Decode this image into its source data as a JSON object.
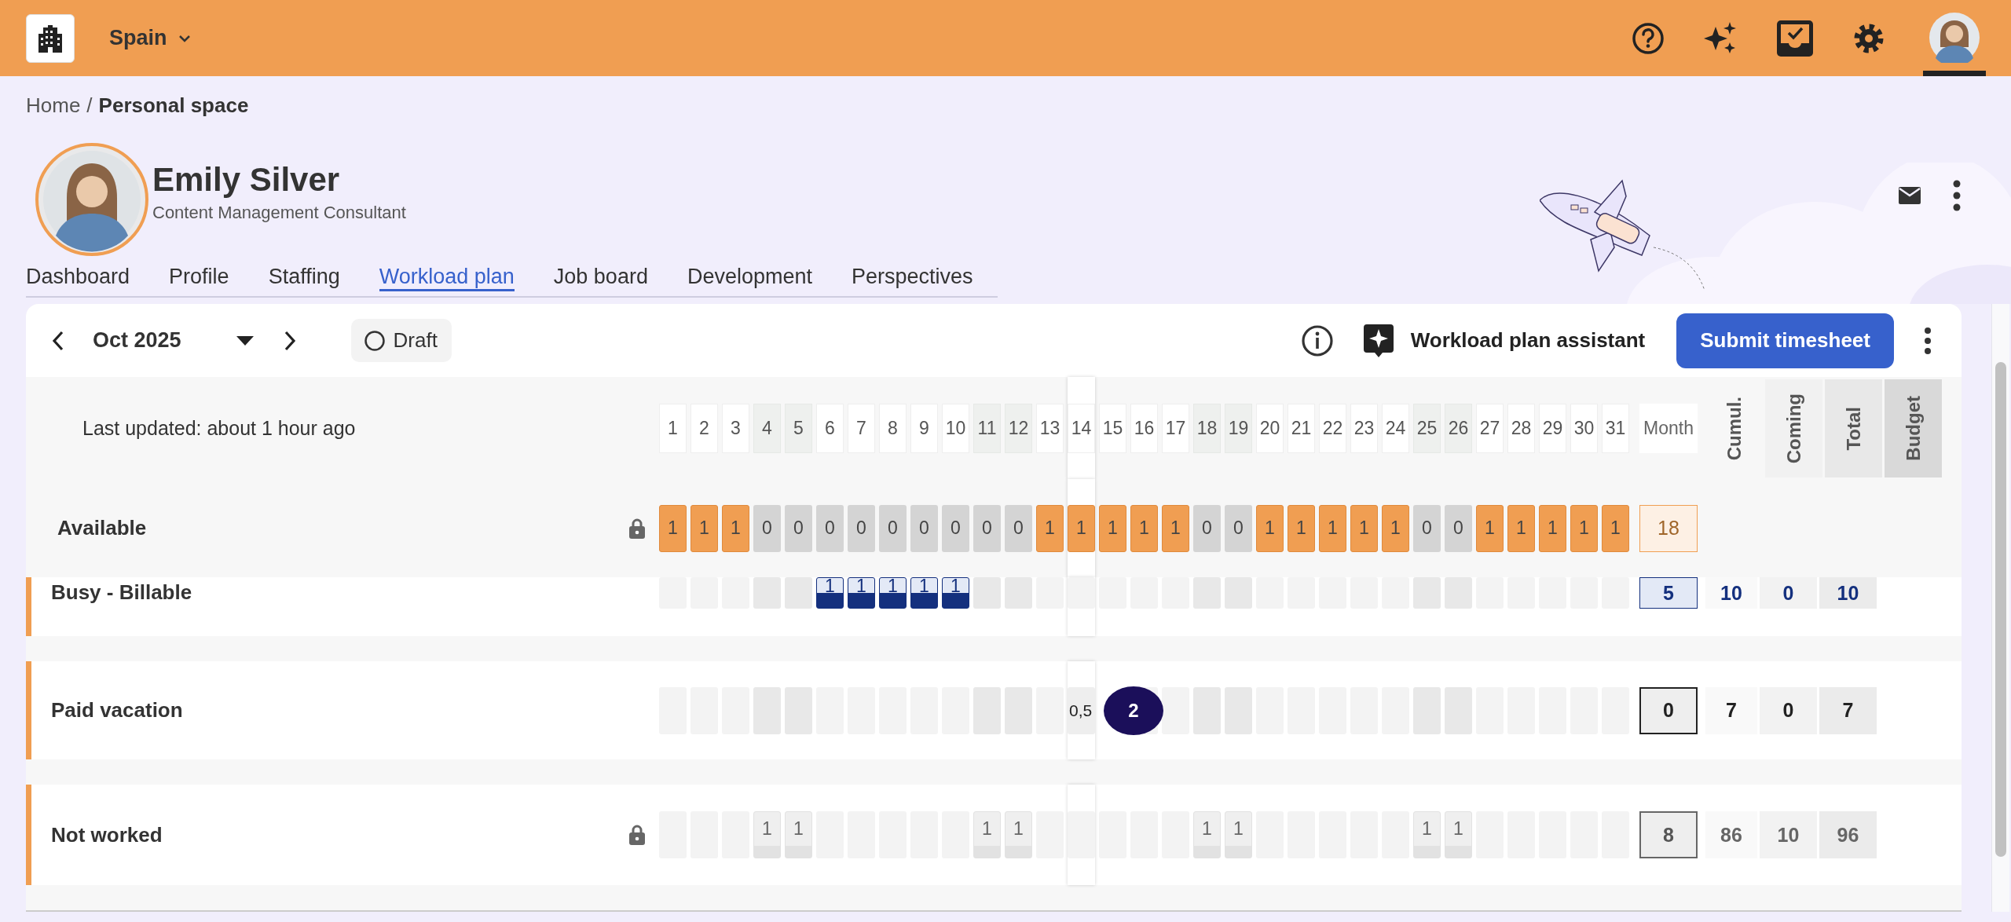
{
  "top_bar": {
    "workspace": "Spain"
  },
  "breadcrumb": {
    "home": "Home",
    "separator": "/",
    "current": "Personal space"
  },
  "profile": {
    "name": "Emily Silver",
    "title": "Content Management Consultant"
  },
  "tabs": [
    {
      "label": "Dashboard",
      "selected": false
    },
    {
      "label": "Profile",
      "selected": false
    },
    {
      "label": "Staffing",
      "selected": false
    },
    {
      "label": "Workload plan",
      "selected": true
    },
    {
      "label": "Job board",
      "selected": false
    },
    {
      "label": "Development",
      "selected": false
    },
    {
      "label": "Perspectives",
      "selected": false
    }
  ],
  "toolbar": {
    "period": "Oct 2025",
    "status": "Draft",
    "assistant": "Workload plan assistant",
    "submit": "Submit timesheet"
  },
  "grid": {
    "last_updated": "Last updated: about 1 hour ago",
    "days": [
      {
        "label": "1",
        "weekend": false,
        "selected": false
      },
      {
        "label": "2",
        "weekend": false,
        "selected": false
      },
      {
        "label": "3",
        "weekend": false,
        "selected": false
      },
      {
        "label": "4",
        "weekend": true,
        "selected": false
      },
      {
        "label": "5",
        "weekend": true,
        "selected": false
      },
      {
        "label": "6",
        "weekend": false,
        "selected": false
      },
      {
        "label": "7",
        "weekend": false,
        "selected": false
      },
      {
        "label": "8",
        "weekend": false,
        "selected": false
      },
      {
        "label": "9",
        "weekend": false,
        "selected": false
      },
      {
        "label": "10",
        "weekend": false,
        "selected": false
      },
      {
        "label": "11",
        "weekend": true,
        "selected": false
      },
      {
        "label": "12",
        "weekend": true,
        "selected": false
      },
      {
        "label": "13",
        "weekend": false,
        "selected": false
      },
      {
        "label": "14",
        "weekend": false,
        "selected": true
      },
      {
        "label": "15",
        "weekend": false,
        "selected": false
      },
      {
        "label": "16",
        "weekend": false,
        "selected": false
      },
      {
        "label": "17",
        "weekend": false,
        "selected": false
      },
      {
        "label": "18",
        "weekend": true,
        "selected": false
      },
      {
        "label": "19",
        "weekend": true,
        "selected": false
      },
      {
        "label": "20",
        "weekend": false,
        "selected": false
      },
      {
        "label": "21",
        "weekend": false,
        "selected": false
      },
      {
        "label": "22",
        "weekend": false,
        "selected": false
      },
      {
        "label": "23",
        "weekend": false,
        "selected": false
      },
      {
        "label": "24",
        "weekend": false,
        "selected": false
      },
      {
        "label": "25",
        "weekend": true,
        "selected": false
      },
      {
        "label": "26",
        "weekend": true,
        "selected": false
      },
      {
        "label": "27",
        "weekend": false,
        "selected": false
      },
      {
        "label": "28",
        "weekend": false,
        "selected": false
      },
      {
        "label": "29",
        "weekend": false,
        "selected": false
      },
      {
        "label": "30",
        "weekend": false,
        "selected": false
      },
      {
        "label": "31",
        "weekend": false,
        "selected": false
      }
    ],
    "columns": [
      "Month",
      "Cumul.",
      "Coming",
      "Total",
      "Budget"
    ],
    "rows": [
      {
        "label": "Available",
        "kind": "available",
        "locked": true,
        "month": "18",
        "cells": [
          {
            "value": "1",
            "kind": "available"
          },
          {
            "value": "1",
            "kind": "available"
          },
          {
            "value": "1",
            "kind": "available"
          },
          {
            "value": "0",
            "kind": "unavailable"
          },
          {
            "value": "0",
            "kind": "unavailable"
          },
          {
            "value": "0",
            "kind": "unavailable"
          },
          {
            "value": "0",
            "kind": "unavailable"
          },
          {
            "value": "0",
            "kind": "unavailable"
          },
          {
            "value": "0",
            "kind": "unavailable"
          },
          {
            "value": "0",
            "kind": "unavailable"
          },
          {
            "value": "0",
            "kind": "unavailable"
          },
          {
            "value": "0",
            "kind": "unavailable"
          },
          {
            "value": "1",
            "kind": "available"
          },
          {
            "value": "1",
            "kind": "available"
          },
          {
            "value": "1",
            "kind": "available"
          },
          {
            "value": "1",
            "kind": "available"
          },
          {
            "value": "1",
            "kind": "available"
          },
          {
            "value": "0",
            "kind": "unavailable"
          },
          {
            "value": "0",
            "kind": "unavailable"
          },
          {
            "value": "1",
            "kind": "available"
          },
          {
            "value": "1",
            "kind": "available"
          },
          {
            "value": "1",
            "kind": "available"
          },
          {
            "value": "1",
            "kind": "available"
          },
          {
            "value": "1",
            "kind": "available"
          },
          {
            "value": "0",
            "kind": "unavailable"
          },
          {
            "value": "0",
            "kind": "unavailable"
          },
          {
            "value": "1",
            "kind": "available"
          },
          {
            "value": "1",
            "kind": "available"
          },
          {
            "value": "1",
            "kind": "available"
          },
          {
            "value": "1",
            "kind": "available"
          },
          {
            "value": "1",
            "kind": "available"
          }
        ]
      },
      {
        "label": "Busy - Billable",
        "kind": "billable",
        "locked": false,
        "month": "5",
        "totals": [
          "10",
          "0",
          "10"
        ],
        "cells": [
          null,
          null,
          null,
          null,
          null,
          {
            "value": "1",
            "kind": "billable"
          },
          {
            "value": "1",
            "kind": "billable"
          },
          {
            "value": "1",
            "kind": "billable"
          },
          {
            "value": "1",
            "kind": "billable"
          },
          {
            "value": "1",
            "kind": "billable"
          },
          null,
          null,
          null,
          null,
          null,
          null,
          null,
          null,
          null,
          null,
          null,
          null,
          null,
          null,
          null,
          null,
          null,
          null,
          null,
          null,
          null
        ]
      },
      {
        "label": "Paid vacation",
        "kind": "vacation",
        "locked": false,
        "month": "0",
        "totals": [
          "7",
          "0",
          "7"
        ],
        "cells": [
          null,
          null,
          null,
          null,
          null,
          null,
          null,
          null,
          null,
          null,
          null,
          null,
          null,
          {
            "value": "0,5",
            "kind": "input"
          },
          {
            "value": "2",
            "kind": "badge"
          },
          null,
          null,
          null,
          null,
          null,
          null,
          null,
          null,
          null,
          null,
          null,
          null,
          null,
          null,
          null,
          null
        ]
      },
      {
        "label": "Not worked",
        "kind": "absence",
        "locked": true,
        "month": "8",
        "totals": [
          "86",
          "10",
          "96"
        ],
        "cells": [
          null,
          null,
          null,
          {
            "value": "1",
            "kind": "absence"
          },
          {
            "value": "1",
            "kind": "absence"
          },
          null,
          null,
          null,
          null,
          null,
          {
            "value": "1",
            "kind": "absence"
          },
          {
            "value": "1",
            "kind": "absence"
          },
          null,
          null,
          null,
          null,
          null,
          {
            "value": "1",
            "kind": "absence"
          },
          {
            "value": "1",
            "kind": "absence"
          },
          null,
          null,
          null,
          null,
          null,
          {
            "value": "1",
            "kind": "absence"
          },
          {
            "value": "1",
            "kind": "absence"
          },
          null,
          null,
          null,
          null,
          null
        ]
      }
    ]
  }
}
